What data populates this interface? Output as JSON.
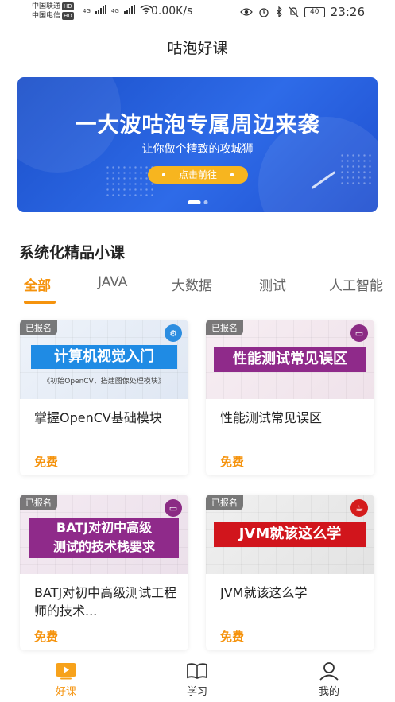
{
  "status_bar": {
    "carrier1": "中国联通",
    "carrier2": "中国电信",
    "hd": "HD",
    "network1": "4G",
    "network2": "4G",
    "speed": "0.00K/s",
    "battery": "40",
    "time": "23:26"
  },
  "header": {
    "title": "咕泡好课"
  },
  "banner": {
    "headline": "一大波咕泡专属周边来袭",
    "subtitle": "让你做个精致的攻城狮",
    "button_label": "点击前往",
    "page_count": 2,
    "active_page": 1
  },
  "section": {
    "title": "系统化精品小课",
    "tabs": [
      {
        "label": "全部",
        "active": true
      },
      {
        "label": "JAVA",
        "active": false
      },
      {
        "label": "大数据",
        "active": false
      },
      {
        "label": "测试",
        "active": false
      },
      {
        "label": "人工智能",
        "active": false
      }
    ]
  },
  "courses": [
    {
      "badge": "已报名",
      "thumb_title": "计算机视觉入门",
      "thumb_caption": "《初始OpenCV，搭建图像处理模块》",
      "title": "掌握OpenCV基础模块",
      "price": "免费",
      "icon": "brain-icon"
    },
    {
      "badge": "已报名",
      "thumb_title": "性能测试常见误区",
      "title": "性能测试常见误区",
      "price": "免费",
      "icon": "monitor-icon"
    },
    {
      "badge": "已报名",
      "thumb_title_line1": "BATJ对初中高级",
      "thumb_title_line2": "测试的技术栈要求",
      "title": "BATJ对初中高级测试工程师的技术...",
      "price": "免费",
      "icon": "monitor-icon"
    },
    {
      "badge": "已报名",
      "thumb_title": "JVM就该这么学",
      "title": "JVM就该这么学",
      "price": "免费",
      "icon": "java-cup-icon"
    }
  ],
  "bottom_nav": [
    {
      "label": "好课",
      "icon": "play-icon",
      "active": true
    },
    {
      "label": "学习",
      "icon": "book-icon",
      "active": false
    },
    {
      "label": "我的",
      "icon": "user-icon",
      "active": false
    }
  ],
  "colors": {
    "accent": "#f5930d",
    "banner_blue": "#2e6be8",
    "banner_button": "#f7b51f"
  }
}
